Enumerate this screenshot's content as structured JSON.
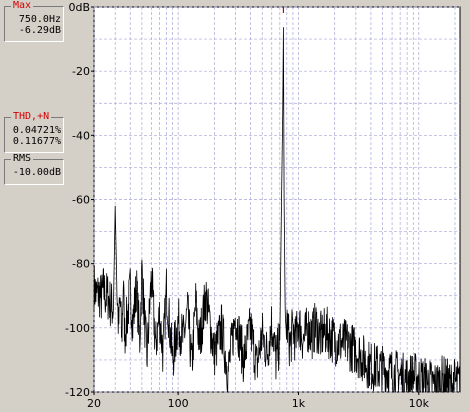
{
  "panel": {
    "max": {
      "caption": "Max",
      "freq": "750.0Hz",
      "level": "-6.29dB"
    },
    "thd": {
      "caption": "THD,+N",
      "thd": "0.04721%",
      "thdn": "0.11677%"
    },
    "rms": {
      "caption": "RMS",
      "level": "-10.00dB"
    }
  },
  "colors": {
    "background": "#ffffff",
    "grid": "#a8a8d8",
    "trace": "#000000",
    "accent": "#d40000"
  },
  "chart_data": {
    "type": "line",
    "xscale": "log",
    "xlim": [
      20,
      22000
    ],
    "ylim": [
      -120,
      0
    ],
    "grid": true,
    "ytick_labels": [
      "0dB",
      "-20",
      "-40",
      "-60",
      "-80",
      "-100",
      "-120"
    ],
    "yticks": [
      0,
      -20,
      -40,
      -60,
      -80,
      -100,
      -120
    ],
    "xtick_labels": [
      "20",
      "100",
      "1k",
      "10k"
    ],
    "xticks": [
      20,
      100,
      1000,
      10000
    ],
    "series": [
      {
        "x": [
          20,
          21,
          22,
          23,
          24,
          25,
          26,
          27,
          28,
          29,
          30,
          31,
          32,
          33,
          34,
          35,
          36,
          38,
          40,
          42,
          45,
          48,
          50,
          55,
          60,
          65,
          70,
          75,
          80,
          90,
          100,
          110,
          120,
          130,
          140,
          150,
          170,
          200,
          230,
          260,
          300,
          350,
          400,
          450,
          500,
          550,
          600,
          650,
          700,
          720,
          740,
          750,
          760,
          780,
          800,
          850,
          900,
          950,
          1000,
          1100,
          1200,
          1300,
          1400,
          1500,
          1700,
          2000,
          2500,
          3000,
          3500,
          4000,
          5000,
          6000,
          7000,
          8000,
          9000,
          10000,
          12000,
          14000,
          16000,
          18000,
          20000,
          22000
        ],
        "y": [
          -87,
          -90,
          -89,
          -91,
          -88,
          -90,
          -90,
          -92,
          -93,
          -94,
          -62,
          -88,
          -100,
          -91,
          -104,
          -86,
          -102,
          -96,
          -88,
          -99,
          -87,
          -104,
          -82,
          -110,
          -84,
          -106,
          -96,
          -108,
          -88,
          -110,
          -98,
          -104,
          -95,
          -112,
          -92,
          -105,
          -90,
          -108,
          -100,
          -114,
          -96,
          -110,
          -100,
          -112,
          -102,
          -108,
          -98,
          -110,
          -104,
          -66,
          -33,
          -6.3,
          -60,
          -104,
          -98,
          -106,
          -100,
          -104,
          -98,
          -104,
          -100,
          -102,
          -99,
          -103,
          -101,
          -104,
          -105,
          -107,
          -110,
          -112,
          -113,
          -114,
          -115,
          -116,
          -115,
          -116,
          -117,
          -118,
          -116,
          -118,
          -117,
          -118
        ]
      }
    ]
  }
}
